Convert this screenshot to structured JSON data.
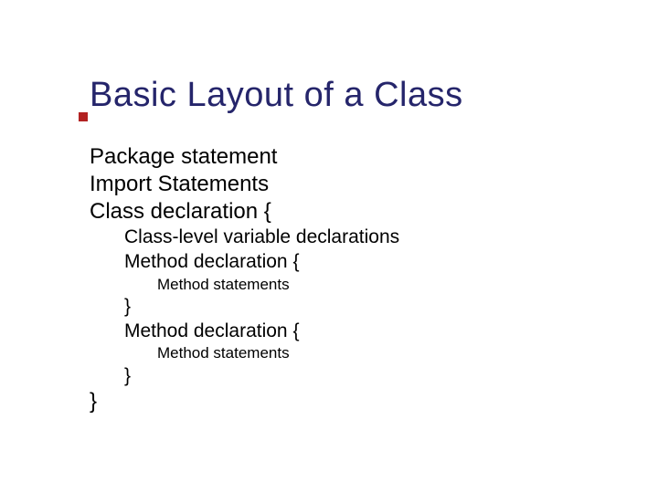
{
  "title": "Basic Layout of a Class",
  "lines": {
    "l1": "Package statement",
    "l2": "Import Statements",
    "l3": "Class declaration {",
    "l4": "Class-level variable declarations",
    "l5": "Method declaration {",
    "l6": "Method statements",
    "l7": "}",
    "l8": "Method declaration {",
    "l9": "Method statements",
    "l10": "}",
    "l11": "}"
  }
}
